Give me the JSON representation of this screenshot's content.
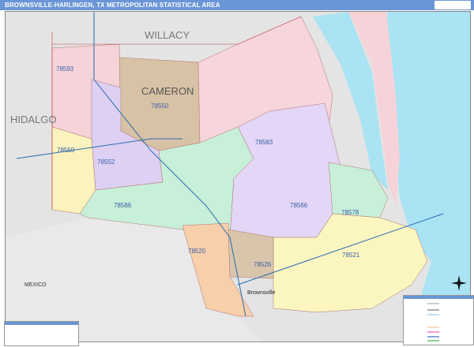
{
  "header": {
    "title": "BROWNSVILLE-HARLINGEN, TX METROPOLITAN STATISTICAL AREA"
  },
  "map": {
    "counties": [
      "WILLACY",
      "HIDALGO",
      "CAMERON"
    ],
    "country": "MEXICO",
    "city": "Brownsville",
    "zips": [
      {
        "zip": "78593",
        "color": "#f6d3d9"
      },
      {
        "zip": "78550",
        "color": "#d8c2a6"
      },
      {
        "zip": "78583",
        "color": "#f7d5dc"
      },
      {
        "zip": "78559",
        "color": "#fbf3bd"
      },
      {
        "zip": "78552",
        "color": "#ddd0f2"
      },
      {
        "zip": "78586",
        "color": "#c8f0d8"
      },
      {
        "zip": "78566",
        "color": "#e3d6f6"
      },
      {
        "zip": "78578",
        "color": "#c8f0d8"
      },
      {
        "zip": "78521",
        "color": "#fbf5c0"
      },
      {
        "zip": "78520",
        "color": "#f8cfab"
      },
      {
        "zip": "78526",
        "color": "#d9c5ab"
      }
    ],
    "colors": {
      "water": "#a9e3f4",
      "land_outside": "#e4e4e4",
      "header": "#6a95d6",
      "label": "#3a5fa8"
    }
  }
}
